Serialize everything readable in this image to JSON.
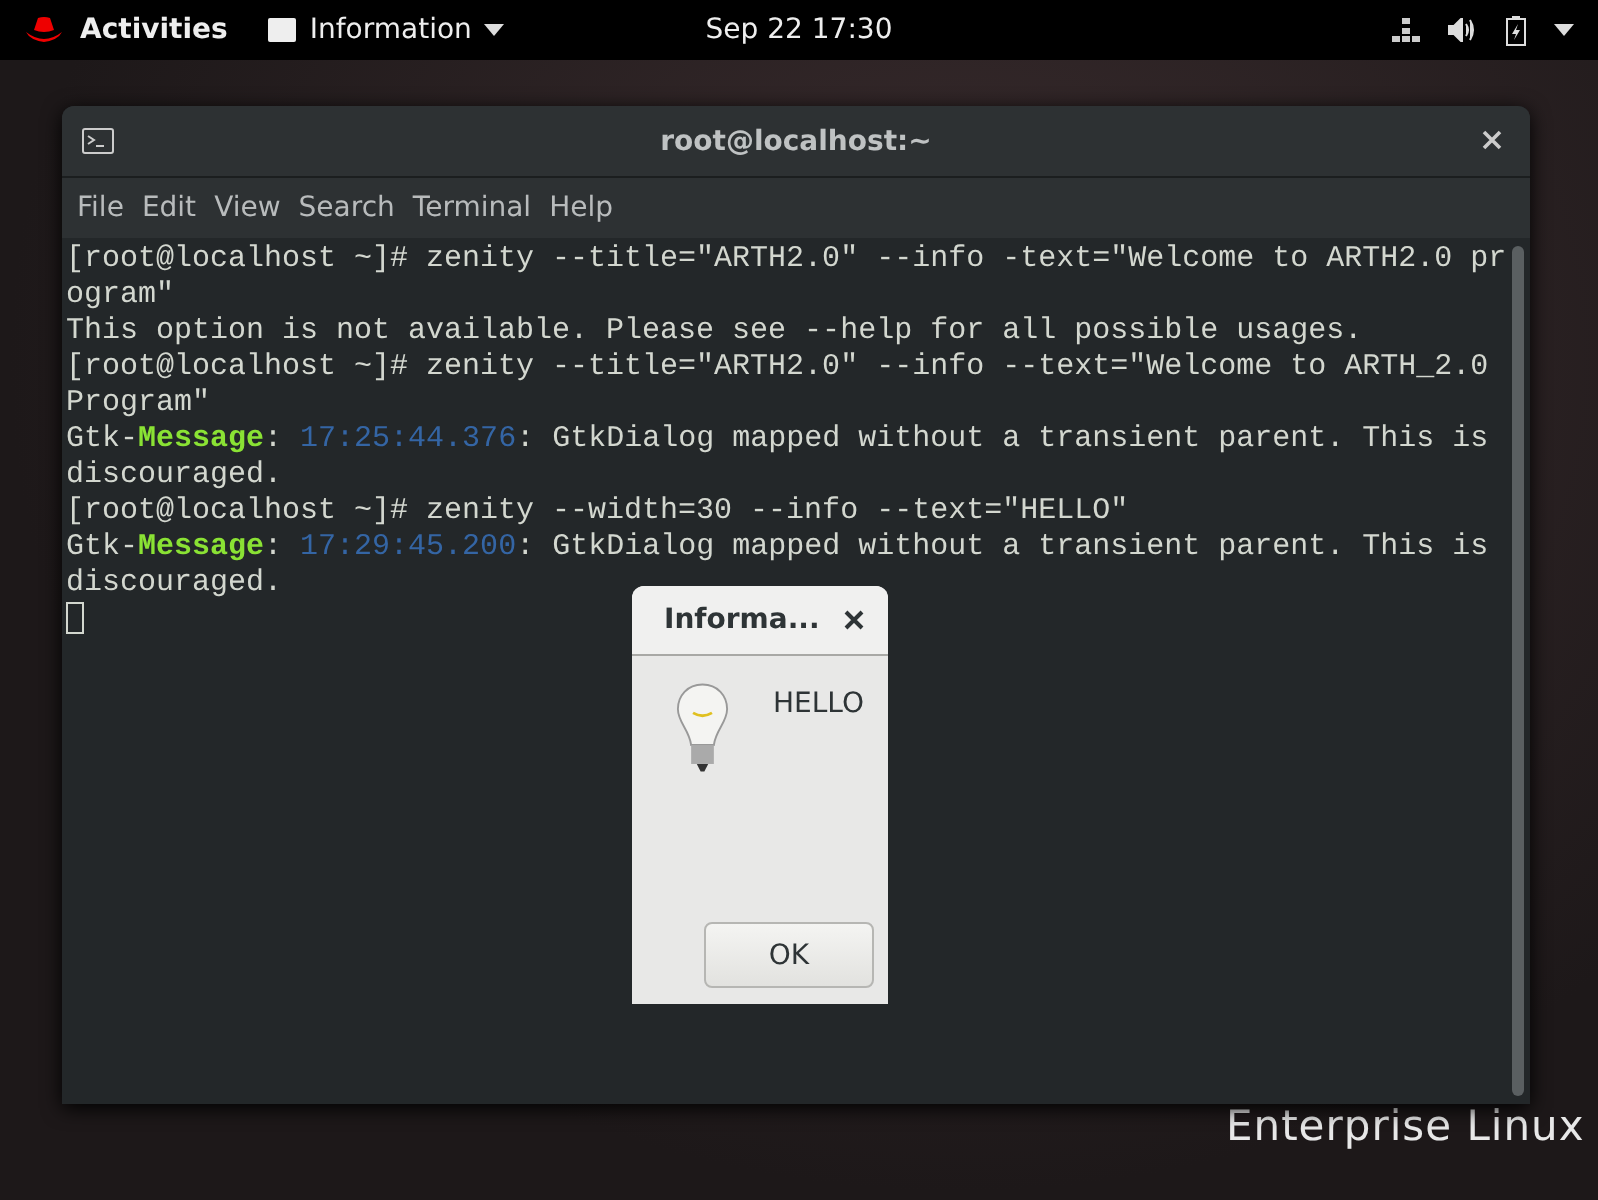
{
  "top_bar": {
    "activities": "Activities",
    "app_menu": "Information",
    "clock": "Sep 22  17:30"
  },
  "window": {
    "title": "root@localhost:~",
    "menu": [
      "File",
      "Edit",
      "View",
      "Search",
      "Terminal",
      "Help"
    ]
  },
  "terminal_lines": [
    [
      {
        "kind": "plain",
        "text": "[root@localhost ~]# zenity --title=\"ARTH2.0\" --info -text=\"Welcome to ARTH2.0 pr"
      }
    ],
    [
      {
        "kind": "plain",
        "text": "ogram\""
      }
    ],
    [
      {
        "kind": "plain",
        "text": "This option is not available. Please see --help for all possible usages."
      }
    ],
    [
      {
        "kind": "plain",
        "text": "[root@localhost ~]# zenity --title=\"ARTH2.0\" --info --text=\"Welcome to ARTH_2.0"
      }
    ],
    [
      {
        "kind": "plain",
        "text": "Program\""
      }
    ],
    [
      {
        "kind": "plain",
        "text": "Gtk-"
      },
      {
        "kind": "message",
        "text": "Message"
      },
      {
        "kind": "plain",
        "text": ": "
      },
      {
        "kind": "time",
        "text": "17:25:44.376"
      },
      {
        "kind": "plain",
        "text": ": GtkDialog mapped without a transient parent. This is"
      }
    ],
    [
      {
        "kind": "plain",
        "text": "discouraged."
      }
    ],
    [
      {
        "kind": "plain",
        "text": "[root@localhost ~]# zenity --width=30 --info --text=\"HELLO\""
      }
    ],
    [
      {
        "kind": "plain",
        "text": "Gtk-"
      },
      {
        "kind": "message",
        "text": "Message"
      },
      {
        "kind": "plain",
        "text": ": "
      },
      {
        "kind": "time",
        "text": "17:29:45.200"
      },
      {
        "kind": "plain",
        "text": ": GtkDialog mapped without a transient parent. This is"
      }
    ],
    [
      {
        "kind": "plain",
        "text": "discouraged."
      }
    ]
  ],
  "dialog": {
    "title": "Informa...",
    "message": "HELLO",
    "button": "OK"
  },
  "wallpaper": {
    "text": "Enterprise Linux"
  }
}
